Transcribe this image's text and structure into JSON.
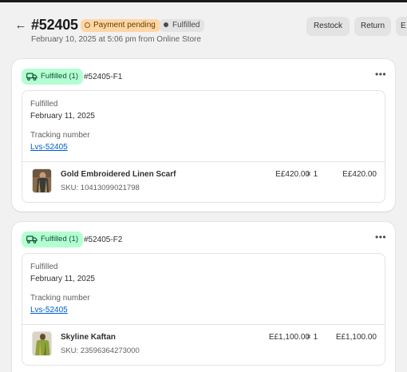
{
  "header": {
    "order_number": "#52405",
    "payment_badge": "Payment pending",
    "fulfillment_badge": "Fulfilled",
    "subtitle": "February 10, 2025 at 5:06 pm from Online Store",
    "buttons": {
      "restock": "Restock",
      "return": "Return",
      "more": "E"
    }
  },
  "fulfillments": [
    {
      "badge": "Fulfilled (1)",
      "id": "#52405-F1",
      "status_label": "Fulfilled",
      "date": "February 11, 2025",
      "tracking_label": "Tracking number",
      "tracking_number": "Lvs-52405",
      "item": {
        "name": "Gold Embroidered Linen Scarf",
        "sku": "SKU: 10413099021798",
        "price": "E£420.00",
        "quantity": "× 1",
        "total": "E£420.00"
      }
    },
    {
      "badge": "Fulfilled (1)",
      "id": "#52405-F2",
      "status_label": "Fulfilled",
      "date": "February 11, 2025",
      "tracking_label": "Tracking number",
      "tracking_number": "Lvs-52405",
      "item": {
        "name": "Skyline Kaftan",
        "sku": "SKU: 23596364273000",
        "price": "E£1,100.00",
        "quantity": "× 1",
        "total": "E£1,100.00"
      }
    }
  ],
  "icons": {
    "back": "arrow-left-icon",
    "more": "horizontal-dots-icon",
    "truck": "truck-icon"
  },
  "colors": {
    "payment_badge_bg": "#ffd6a4",
    "fulfilled_badge_bg": "#b4fed2",
    "link": "#005bd3"
  }
}
